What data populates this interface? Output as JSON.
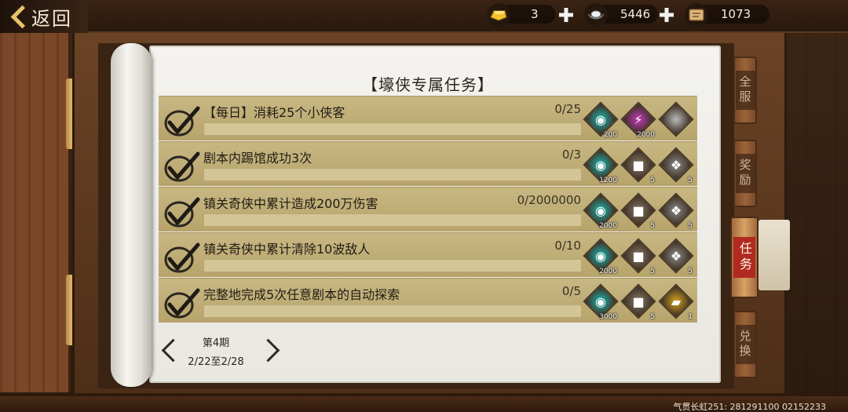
{
  "header": {
    "back_label": "返回",
    "resources": [
      {
        "icon": "gold-ingot-icon",
        "value": "3"
      },
      {
        "icon": "silver-ingot-icon",
        "value": "5446"
      },
      {
        "icon": "scroll-ticket-icon",
        "value": "1073"
      }
    ]
  },
  "panel": {
    "title": "【壕侠专属任务】",
    "tasks": [
      {
        "name": "【每日】消耗25个小侠客",
        "progress": "0/25",
        "progress_fraction": 0,
        "rewards": [
          {
            "icon": "teal-token-icon",
            "count": "200",
            "color": "#1fb7b0"
          },
          {
            "icon": "purple-token-icon",
            "count": "2000",
            "color": "#c23bb9"
          },
          {
            "icon": "empty-reward-icon",
            "count": "",
            "color": "#b9b9b9"
          }
        ]
      },
      {
        "name": "剧本内踢馆成功3次",
        "progress": "0/3",
        "progress_fraction": 0,
        "rewards": [
          {
            "icon": "teal-token-icon",
            "count": "1200",
            "color": "#1fb7b0"
          },
          {
            "icon": "iron-block-icon",
            "count": "5",
            "color": "#8c7a6a"
          },
          {
            "icon": "silver-ore-icon",
            "count": "5",
            "color": "#8c8a88"
          }
        ]
      },
      {
        "name": "镇关奇侠中累计造成200万伤害",
        "progress": "0/2000000",
        "progress_fraction": 0,
        "rewards": [
          {
            "icon": "teal-token-icon",
            "count": "2000",
            "color": "#1fb7b0"
          },
          {
            "icon": "iron-block-icon",
            "count": "5",
            "color": "#8c7a6a"
          },
          {
            "icon": "silver-ore-icon",
            "count": "5",
            "color": "#8c8a88"
          }
        ]
      },
      {
        "name": "镇关奇侠中累计清除10波敌人",
        "progress": "0/10",
        "progress_fraction": 0,
        "rewards": [
          {
            "icon": "teal-token-icon",
            "count": "2000",
            "color": "#1fb7b0"
          },
          {
            "icon": "iron-block-icon",
            "count": "5",
            "color": "#8c7a6a"
          },
          {
            "icon": "silver-ore-icon",
            "count": "5",
            "color": "#8c8a88"
          }
        ]
      },
      {
        "name": "完整地完成5次任意剧本的自动探索",
        "progress": "0/5",
        "progress_fraction": 0,
        "rewards": [
          {
            "icon": "teal-token-icon",
            "count": "3000",
            "color": "#1fb7b0"
          },
          {
            "icon": "iron-block-icon",
            "count": "5",
            "color": "#8c7a6a"
          },
          {
            "icon": "gold-box-icon",
            "count": "1",
            "color": "#d8a21e"
          }
        ]
      }
    ],
    "pager": {
      "period": "第4期",
      "dates": "2/22至2/28"
    }
  },
  "side_tabs": [
    {
      "label": "全服",
      "active": false
    },
    {
      "label": "奖励",
      "active": false
    },
    {
      "label": "任务",
      "active": true
    },
    {
      "label": "兑换",
      "active": false
    }
  ],
  "footer": {
    "watermark": "气贯长虹251: 281291100 02152233"
  }
}
